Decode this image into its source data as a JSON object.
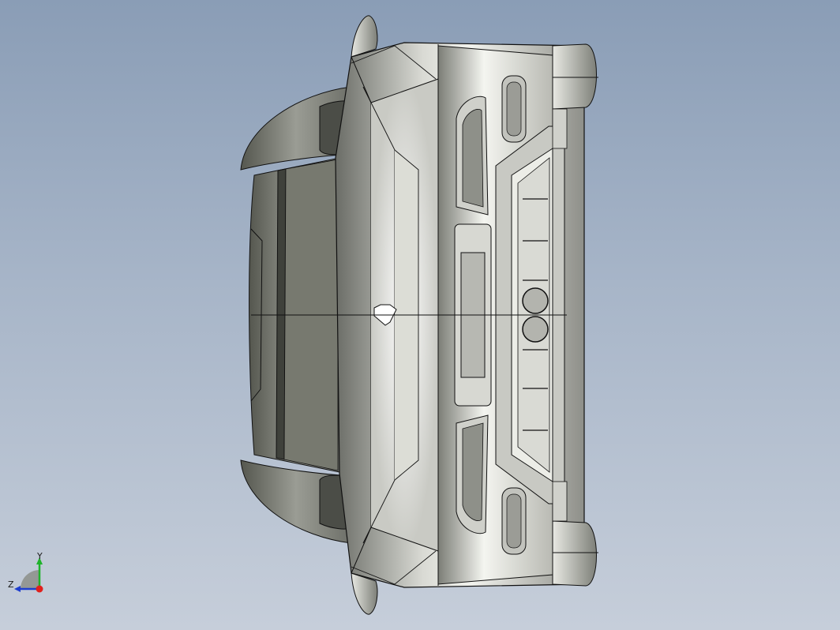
{
  "view": {
    "model": "car-body-front-view"
  },
  "triad": {
    "y_label": "Y",
    "z_label": "Z",
    "x_color": "#e0201c",
    "y_color": "#1fb32b",
    "z_color": "#1e3ecf"
  },
  "colors": {
    "body_light": "#e9ebe4",
    "body_mid": "#a9aaa4",
    "body_dark": "#5e605a",
    "edge": "#111111"
  }
}
